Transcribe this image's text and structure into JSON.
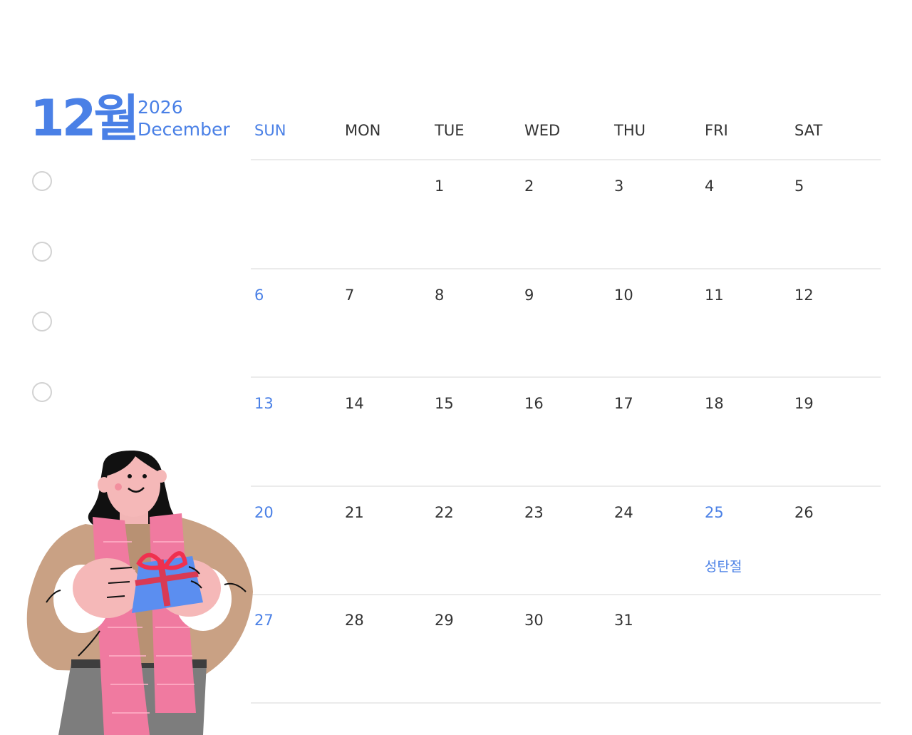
{
  "header": {
    "month_ko": "12월",
    "year": "2026",
    "month_en": "December"
  },
  "weekdays": [
    "SUN",
    "MON",
    "TUE",
    "WED",
    "THU",
    "FRI",
    "SAT"
  ],
  "weeks": [
    [
      "",
      "",
      "1",
      "2",
      "3",
      "4",
      "5"
    ],
    [
      "6",
      "7",
      "8",
      "9",
      "10",
      "11",
      "12"
    ],
    [
      "13",
      "14",
      "15",
      "16",
      "17",
      "18",
      "19"
    ],
    [
      "20",
      "21",
      "22",
      "23",
      "24",
      "25",
      "26"
    ],
    [
      "27",
      "28",
      "29",
      "30",
      "31",
      "",
      ""
    ]
  ],
  "holidays": [
    {
      "date": "25",
      "label": "성탄절"
    }
  ],
  "checklist_items": 4,
  "colors": {
    "accent": "#4a80e6",
    "text": "#333333",
    "divider": "#ebebeb"
  }
}
